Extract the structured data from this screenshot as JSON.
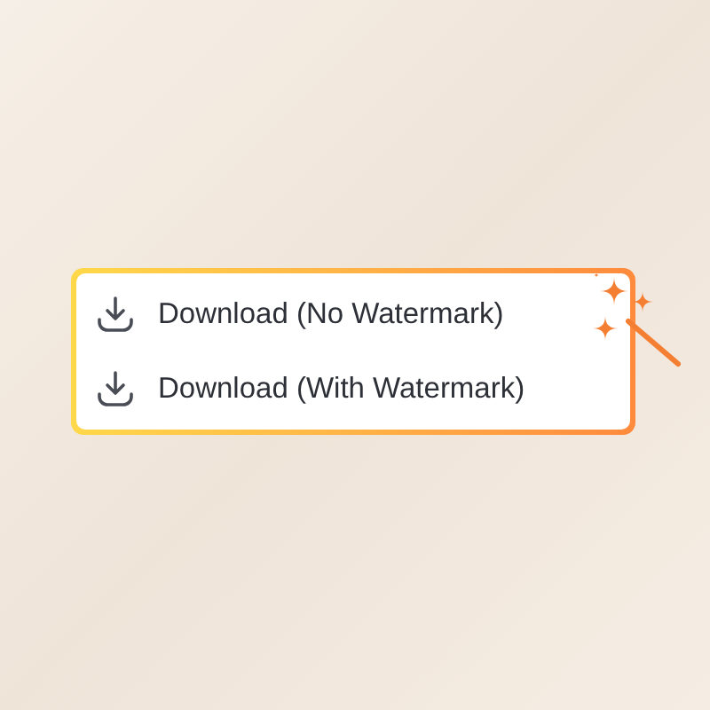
{
  "menu": {
    "items": [
      {
        "label": "Download (No Watermark)"
      },
      {
        "label": "Download (With Watermark)"
      }
    ]
  }
}
